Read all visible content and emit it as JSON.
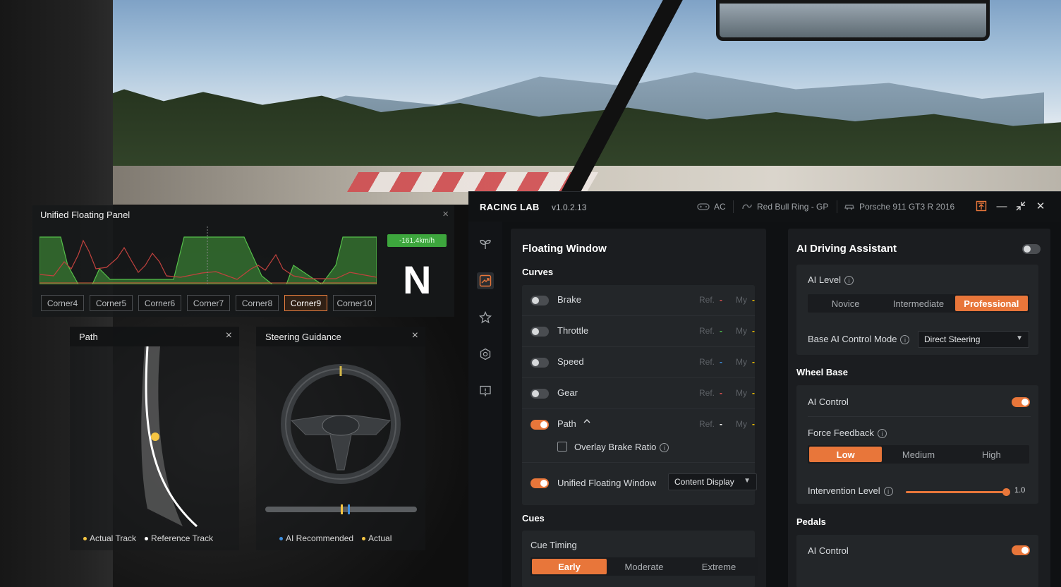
{
  "unified_panel": {
    "title": "Unified Floating Panel",
    "close": "×",
    "speed": "-161.4km/h",
    "gear": "N",
    "corners": [
      "Corner4",
      "Corner5",
      "Corner6",
      "Corner7",
      "Corner8",
      "Corner9",
      "Corner10"
    ],
    "active_corner": "Corner9"
  },
  "path_panel": {
    "title": "Path",
    "close": "×",
    "legend": [
      "Actual Track",
      "Reference Track"
    ]
  },
  "steering_panel": {
    "title": "Steering Guidance",
    "close": "×",
    "legend": [
      "AI Recommended",
      "Actual"
    ]
  },
  "app": {
    "name": "RACING LAB",
    "version": "v1.0.2.13",
    "status": {
      "sim": "AC",
      "track": "Red Bull Ring - GP",
      "car": "Porsche 911 GT3 R 2016"
    },
    "window_buttons": {
      "minimize": "—",
      "close": "✕"
    }
  },
  "floating_window": {
    "title": "Floating Window",
    "curves_title": "Curves",
    "ref_label": "Ref.",
    "my_label": "My",
    "curves": [
      {
        "label": "Brake",
        "on": false,
        "ref_color": "#e05252",
        "my_color": "#f0c000"
      },
      {
        "label": "Throttle",
        "on": false,
        "ref_color": "#4cc24c",
        "my_color": "#f0c000"
      },
      {
        "label": "Speed",
        "on": false,
        "ref_color": "#3d8fe0",
        "my_color": "#f0c000"
      },
      {
        "label": "Gear",
        "on": false,
        "ref_color": "#e05252",
        "my_color": "#f0c000"
      },
      {
        "label": "Path",
        "on": true,
        "ref_color": "#ffffff",
        "my_color": "#f0c000"
      }
    ],
    "overlay_brake_ratio": "Overlay Brake Ratio",
    "unified_window_label": "Unified Floating Window",
    "unified_window_select": "Content Display",
    "cues_title": "Cues",
    "cue_timing_label": "Cue Timing",
    "cue_timing_options": [
      "Early",
      "Moderate",
      "Extreme"
    ],
    "cue_timing_selected": "Early"
  },
  "ai_assistant": {
    "title": "AI Driving Assistant",
    "enabled": false,
    "ai_level_label": "AI Level",
    "ai_level_options": [
      "Novice",
      "Intermediate",
      "Professional"
    ],
    "ai_level_selected": "Professional",
    "base_mode_label": "Base AI Control Mode",
    "base_mode_value": "Direct Steering",
    "wheel_base_title": "Wheel Base",
    "wheel_ai_control_label": "AI Control",
    "wheel_ai_control_on": true,
    "force_feedback_label": "Force Feedback",
    "force_feedback_options": [
      "Low",
      "Medium",
      "High"
    ],
    "force_feedback_selected": "Low",
    "intervention_label": "Intervention Level",
    "intervention_value": "1.0",
    "pedals_title": "Pedals",
    "pedals_ai_control_label": "AI Control",
    "pedals_ai_control_on": true
  },
  "colors": {
    "accent": "#e8763a",
    "speed_badge": "#3da63d",
    "actual_dot": "#f5c542",
    "reference_dot": "#ffffff",
    "ai_recommended_dot": "#3d8fe0"
  }
}
